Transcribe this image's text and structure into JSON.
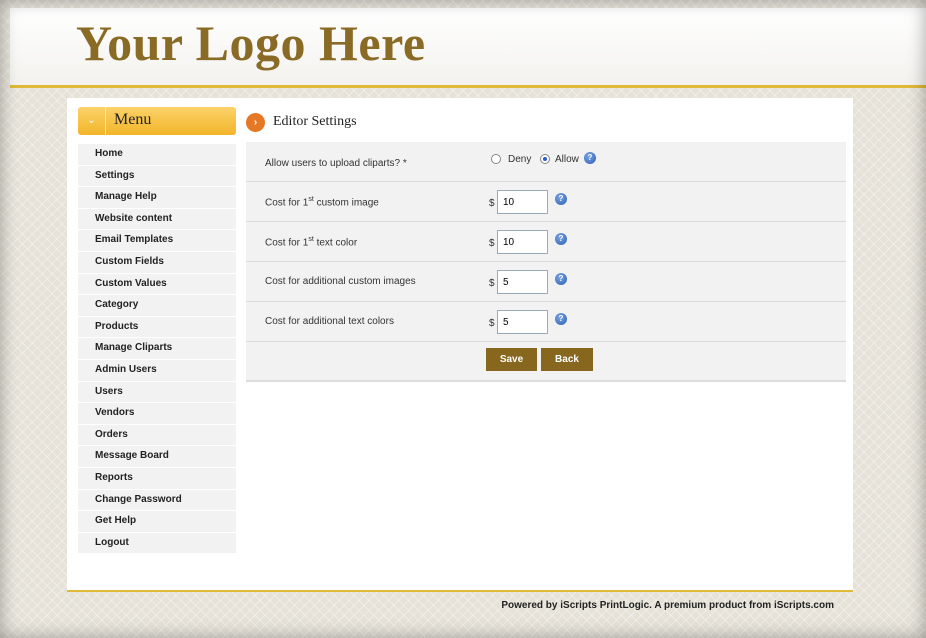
{
  "brand": {
    "logo_text": "Your Logo Here"
  },
  "menu": {
    "title": "Menu",
    "items": [
      "Home",
      "Settings",
      "Manage Help",
      "Website content",
      "Email Templates",
      "Custom Fields",
      "Custom Values",
      "Category",
      "Products",
      "Manage Cliparts",
      "Admin Users",
      "Users",
      "Vendors",
      "Orders",
      "Message Board",
      "Reports",
      "Change Password",
      "Get Help",
      "Logout"
    ]
  },
  "page": {
    "title": "Editor Settings"
  },
  "form": {
    "upload_cliparts": {
      "label": "Allow users to upload cliparts? *",
      "options": [
        "Deny",
        "Allow"
      ],
      "selected": "Allow"
    },
    "currency": "$",
    "rows": [
      {
        "label_pre": "Cost for 1",
        "label_sup": "st",
        "label_post": " custom image",
        "value": "10"
      },
      {
        "label_pre": "Cost for 1",
        "label_sup": "st",
        "label_post": " text color",
        "value": "10"
      },
      {
        "label_pre": "Cost for additional custom images",
        "label_sup": "",
        "label_post": "",
        "value": "5"
      },
      {
        "label_pre": "Cost for additional text colors",
        "label_sup": "",
        "label_post": "",
        "value": "5"
      }
    ],
    "save_label": "Save",
    "back_label": "Back",
    "help_glyph": "?"
  },
  "footer": {
    "text": "Powered by iScripts PrintLogic. A premium product from iScripts.com"
  },
  "colors": {
    "accent": "#e0b938",
    "button": "#87661e",
    "logo": "#8a6b25",
    "title_icon": "#e57825"
  },
  "icons": {
    "menu_toggle": "chevron-down-icon",
    "title": "arrow-right-circle-icon",
    "help": "help-icon"
  }
}
